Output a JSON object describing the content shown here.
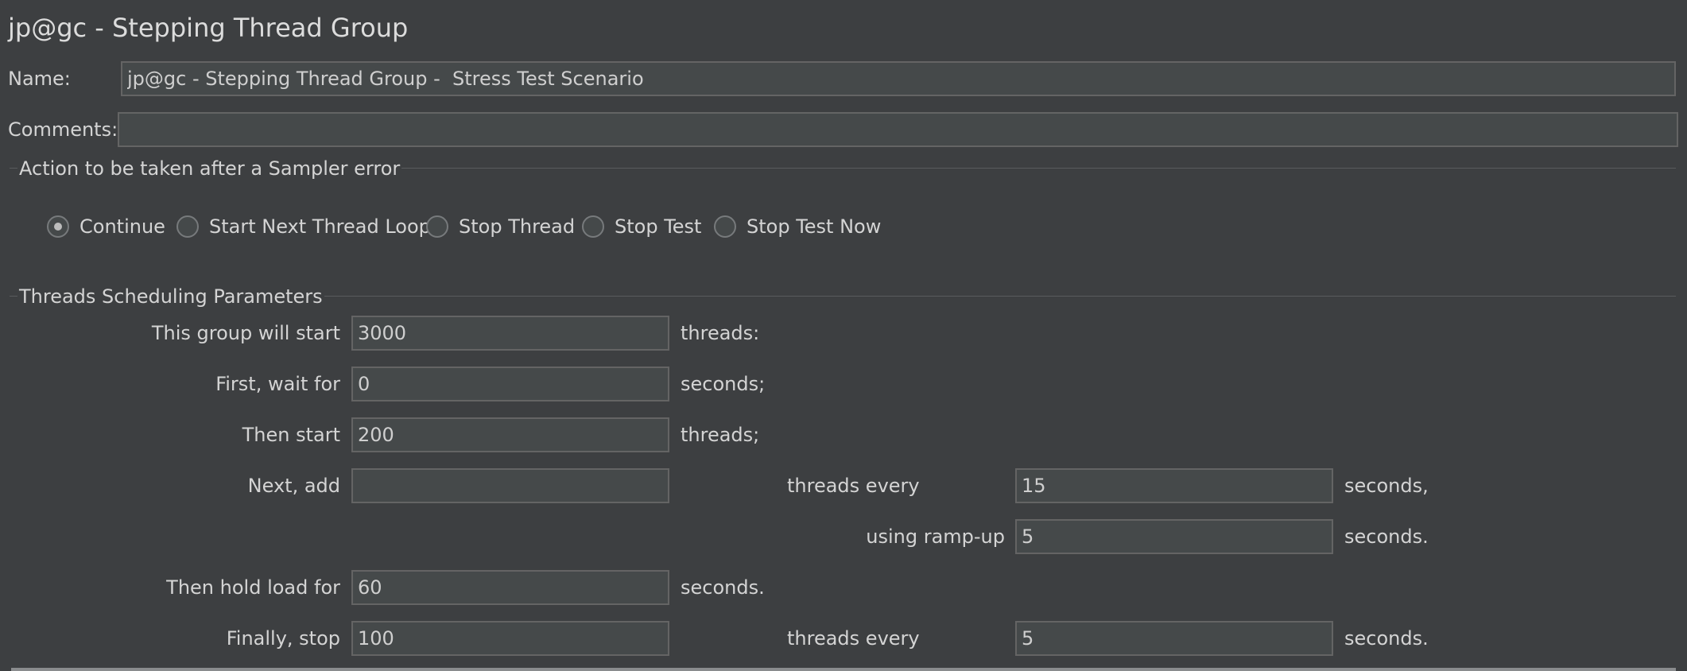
{
  "window": {
    "title": "jp@gc - Stepping Thread Group"
  },
  "form": {
    "name_label": "Name:",
    "name_value": "jp@gc - Stepping Thread Group -  Stress Test Scenario",
    "comments_label": "Comments:",
    "comments_value": ""
  },
  "sampler_error": {
    "title": "Action to be taken after a Sampler error",
    "options": [
      {
        "label": "Continue",
        "selected": true
      },
      {
        "label": "Start Next Thread Loop",
        "selected": false
      },
      {
        "label": "Stop Thread",
        "selected": false
      },
      {
        "label": "Stop Test",
        "selected": false
      },
      {
        "label": "Stop Test Now",
        "selected": false
      }
    ]
  },
  "scheduling": {
    "title": "Threads Scheduling Parameters",
    "start_label": "This group will start",
    "start_value": "3000",
    "start_unit": "threads:",
    "wait_label": "First, wait for",
    "wait_value": "0",
    "wait_unit": "seconds;",
    "then_start_label": "Then start",
    "then_start_value": "200",
    "then_start_unit": "threads;",
    "next_add_label": "Next, add",
    "next_add_value": "",
    "next_add_every_label": "threads every",
    "next_add_every_value": "15",
    "next_add_every_unit": "seconds,",
    "rampup_label": "using ramp-up",
    "rampup_value": "5",
    "rampup_unit": "seconds.",
    "hold_label": "Then hold load for",
    "hold_value": "60",
    "hold_unit": "seconds.",
    "stop_label": "Finally, stop",
    "stop_value": "100",
    "stop_every_label": "threads every",
    "stop_every_value": "5",
    "stop_every_unit": "seconds."
  }
}
